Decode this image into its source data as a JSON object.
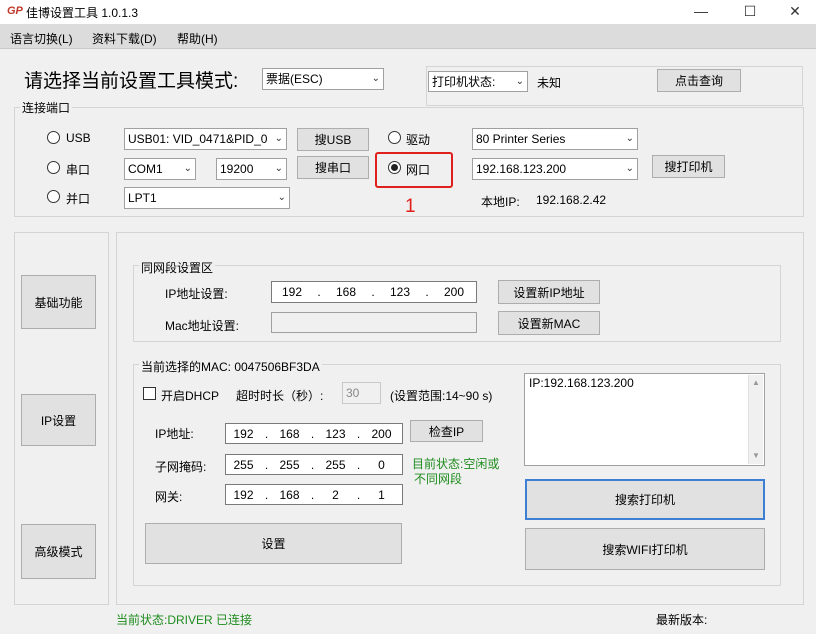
{
  "window": {
    "title": "佳博设置工具 1.0.1.3",
    "icon_text": "GP",
    "minimize": "—",
    "maximize": "☐",
    "close": "✕"
  },
  "menu": [
    "语言切换(L)",
    "资料下载(D)",
    "帮助(H)"
  ],
  "mode": {
    "label": "请选择当前设置工具模式:",
    "value": "票据(ESC)",
    "printer_status_label": "打印机状态:",
    "printer_status_value": "未知",
    "query_button": "点击查询"
  },
  "port": {
    "group_title": "连接端口",
    "usb_label": "USB",
    "usb_value": "USB01: VID_0471&PID_0",
    "search_usb": "搜USB",
    "driver_label": "驱动",
    "driver_value": "80 Printer Series",
    "serial_label": "串口",
    "com_value": "COM1",
    "baud_value": "19200",
    "search_serial": "搜串口",
    "net_label": "网口",
    "net_value": "192.168.123.200",
    "search_printer": "搜打印机",
    "parallel_label": "并口",
    "lpt_value": "LPT1",
    "local_ip_label": "本地IP:",
    "local_ip_value": "192.168.2.42",
    "annotation_number": "1",
    "selected": "net"
  },
  "sidebar": {
    "basic": "基础功能",
    "ip_settings": "IP设置",
    "advanced": "高级模式"
  },
  "same_segment": {
    "title": "同网段设置区",
    "ip_label": "IP地址设置:",
    "ip": [
      "192",
      "168",
      "123",
      "200"
    ],
    "set_ip_button": "设置新IP地址",
    "mac_label": "Mac地址设置:",
    "set_mac_button": "设置新MAC"
  },
  "current": {
    "mac_title": "当前选择的MAC: 0047506BF3DA",
    "dhcp_label": "开启DHCP",
    "timeout_label": "超时时长（秒）:",
    "timeout_value": "30",
    "range_label": "(设置范围:14~90 s)",
    "ip_label": "IP地址:",
    "ip": [
      "192",
      "168",
      "123",
      "200"
    ],
    "check_ip_button": "检查IP",
    "mask_label": "子网掩码:",
    "mask": [
      "255",
      "255",
      "255",
      "0"
    ],
    "state_line1": "目前状态:空闲或",
    "state_line2": "不同网段",
    "gateway_label": "网关:",
    "gateway": [
      "192",
      "168",
      "2",
      "1"
    ],
    "set_button": "设置",
    "info_text": "IP:192.168.123.200",
    "search_printer_button": "搜索打印机",
    "search_wifi_button": "搜索WIFI打印机"
  },
  "status": {
    "current": "当前状态:DRIVER  已连接",
    "latest_version": "最新版本:"
  },
  "colors": {
    "accent_red": "#e0201c",
    "status_green": "#1e8c1e",
    "focus_blue": "#3c7fd3"
  }
}
